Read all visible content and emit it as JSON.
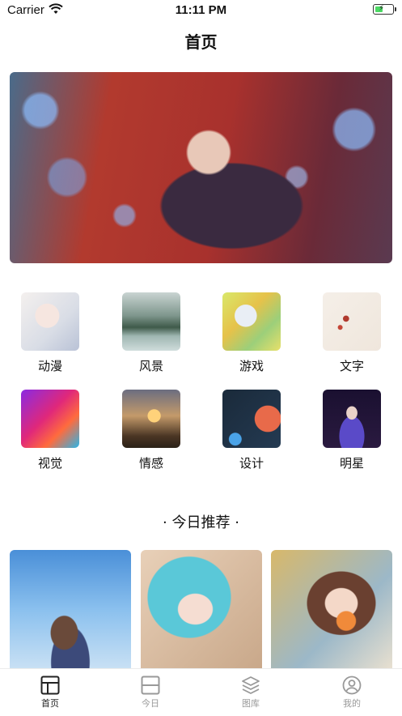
{
  "status_bar": {
    "carrier": "Carrier",
    "time": "11:11 PM"
  },
  "nav": {
    "title": "首页"
  },
  "categories": [
    {
      "label": "动漫",
      "icon": "anime-thumb"
    },
    {
      "label": "风景",
      "icon": "landscape-thumb"
    },
    {
      "label": "游戏",
      "icon": "game-thumb"
    },
    {
      "label": "文字",
      "icon": "text-thumb"
    },
    {
      "label": "视觉",
      "icon": "visual-thumb"
    },
    {
      "label": "情感",
      "icon": "emotion-thumb"
    },
    {
      "label": "设计",
      "icon": "design-thumb"
    },
    {
      "label": "明星",
      "icon": "star-thumb"
    }
  ],
  "section": {
    "title": "· 今日推荐 ·"
  },
  "tabs": [
    {
      "label": "首页",
      "icon": "home-icon",
      "active": true
    },
    {
      "label": "今日",
      "icon": "today-icon",
      "active": false
    },
    {
      "label": "图库",
      "icon": "gallery-layers-icon",
      "active": false
    },
    {
      "label": "我的",
      "icon": "profile-icon",
      "active": false
    }
  ]
}
